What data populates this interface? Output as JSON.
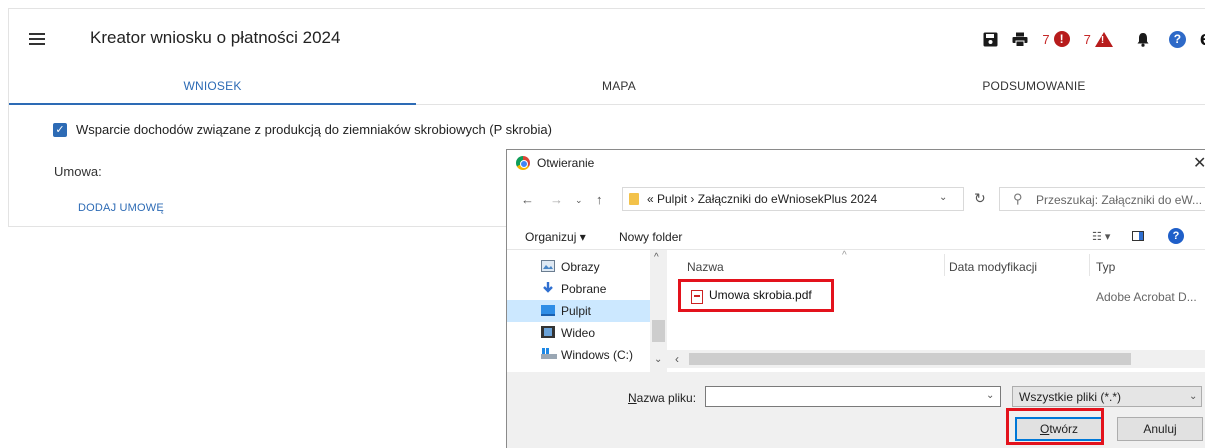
{
  "app": {
    "title": "Kreator wniosku o płatności 2024",
    "toolbar": {
      "error_count": "7",
      "warning_count": "7",
      "error_glyph": "!",
      "warning_glyph": "!",
      "help_glyph": "?",
      "user_glyph": "e"
    },
    "tabs": [
      {
        "label": "WNIOSEK",
        "active": true
      },
      {
        "label": "MAPA",
        "active": false
      },
      {
        "label": "PODSUMOWANIE",
        "active": false
      }
    ],
    "checkbox_label": "Wsparcie dochodów związane z produkcją do ziemniaków skrobiowych (P skrobia)",
    "checkbox_checked": true,
    "umowa_label": "Umowa:",
    "add_umowa_label": "DODAJ UMOWĘ",
    "accent_color": "#2d6bb5"
  },
  "dialog": {
    "title": "Otwieranie",
    "breadcrumb": "« Pulpit › Załączniki do eWniosekPlus 2024",
    "search_placeholder": "Przeszukaj: Załączniki do eW...",
    "organize_label": "Organizuj ▾",
    "new_folder_label": "Nowy folder",
    "nav_items": [
      {
        "label": "Obrazy",
        "icon": "pictures-icon",
        "selected": false
      },
      {
        "label": "Pobrane",
        "icon": "downloads-icon",
        "selected": false
      },
      {
        "label": "Pulpit",
        "icon": "desktop-icon",
        "selected": true
      },
      {
        "label": "Wideo",
        "icon": "video-icon",
        "selected": false
      },
      {
        "label": "Windows (C:)",
        "icon": "drive-icon",
        "selected": false
      }
    ],
    "columns": {
      "name": "Nazwa",
      "modified": "Data modyfikacji",
      "type": "Typ"
    },
    "files": [
      {
        "name": "Umowa skrobia.pdf",
        "modified": "",
        "type": "Adobe Acrobat D..."
      }
    ],
    "filename_label_u": "N",
    "filename_label_rest": "azwa pliku:",
    "filename_value": "",
    "filter_value": "Wszystkie pliki (*.*)",
    "open_label_u": "O",
    "open_label_rest": "twórz",
    "cancel_label": "Anuluj",
    "highlight_color": "#e3121c"
  }
}
